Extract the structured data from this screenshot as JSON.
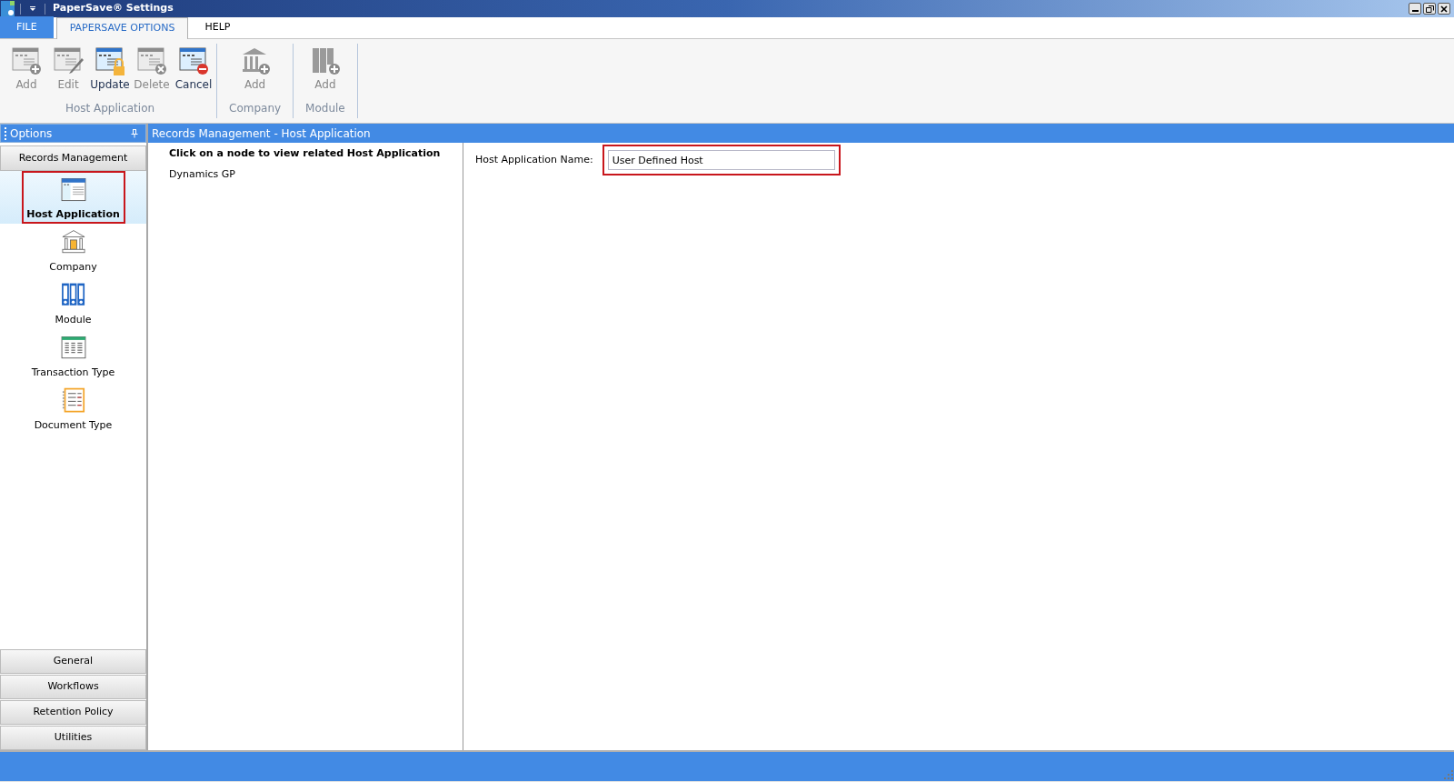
{
  "window": {
    "title": "PaperSave® Settings"
  },
  "tabs": [
    {
      "label": "FILE",
      "kind": "file",
      "selected": false
    },
    {
      "label": "PAPERSAVE OPTIONS",
      "kind": "tab",
      "selected": true
    },
    {
      "label": "HELP",
      "kind": "tab",
      "selected": false
    }
  ],
  "ribbon": {
    "groups": [
      {
        "label": "Host Application",
        "buttons": [
          {
            "label": "Add",
            "disabled": true
          },
          {
            "label": "Edit",
            "disabled": true
          },
          {
            "label": "Update",
            "disabled": false
          },
          {
            "label": "Delete",
            "disabled": true
          },
          {
            "label": "Cancel",
            "disabled": false
          }
        ]
      },
      {
        "label": "Company",
        "buttons": [
          {
            "label": "Add",
            "disabled": true
          }
        ]
      },
      {
        "label": "Module",
        "buttons": [
          {
            "label": "Add",
            "disabled": true
          }
        ]
      }
    ]
  },
  "sidebar": {
    "title": "Options",
    "section": "Records Management",
    "items": [
      {
        "label": "Host Application",
        "selected": true,
        "highlighted": true
      },
      {
        "label": "Company",
        "selected": false,
        "highlighted": false
      },
      {
        "label": "Module",
        "selected": false,
        "highlighted": false
      },
      {
        "label": "Transaction Type",
        "selected": false,
        "highlighted": false
      },
      {
        "label": "Document Type",
        "selected": false,
        "highlighted": false
      }
    ],
    "sections": [
      "General",
      "Workflows",
      "Retention Policy",
      "Utilities"
    ]
  },
  "content": {
    "header": "Records Management - Host Application",
    "tree": {
      "instruction": "Click on a node to view related Host Application",
      "nodes": [
        "Dynamics GP"
      ]
    },
    "form": {
      "label": "Host Application Name:",
      "value": "User Defined Host",
      "highlighted": true
    }
  }
}
